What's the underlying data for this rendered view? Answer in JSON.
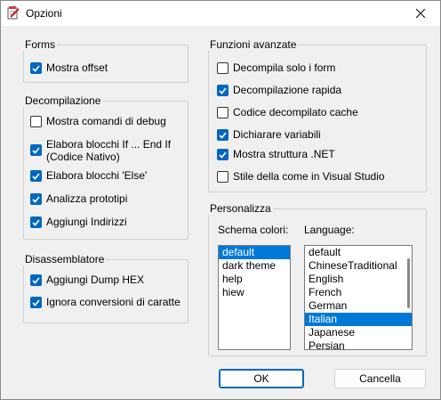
{
  "window": {
    "title": "Opzioni"
  },
  "forms": {
    "title": "Forms",
    "items": [
      {
        "label": "Mostra offset",
        "checked": true
      }
    ]
  },
  "decompilazione": {
    "title": "Decompilazione",
    "items": [
      {
        "label": "Mostra comandi di debug",
        "checked": false
      },
      {
        "label": "Elabora blocchi If ... End If\n(Codice Nativo)",
        "checked": true
      },
      {
        "label": "Elabora blocchi 'Else'",
        "checked": true
      },
      {
        "label": "Analizza prototipi",
        "checked": true
      },
      {
        "label": "Aggiungi Indirizzi",
        "checked": true
      }
    ]
  },
  "disassemblatore": {
    "title": "Disassemblatore",
    "items": [
      {
        "label": "Aggiungi Dump HEX",
        "checked": true
      },
      {
        "label": "Ignora conversioni di caratte",
        "checked": true
      }
    ]
  },
  "funzioni": {
    "title": "Funzioni avanzate",
    "items": [
      {
        "label": "Decompila solo i form",
        "checked": false
      },
      {
        "label": "Decompilazione rapida",
        "checked": true
      },
      {
        "label": "Codice decompilato cache",
        "checked": false
      },
      {
        "label": "Dichiarare variabili",
        "checked": true
      },
      {
        "label": "Mostra struttura .NET",
        "checked": true
      },
      {
        "label": "Stile della come in Visual Studio",
        "checked": false
      }
    ]
  },
  "personalizza": {
    "title": "Personalizza",
    "schema_label": "Schema colori:",
    "schema_items": [
      "default",
      "dark theme",
      "help",
      "hiew"
    ],
    "schema_selected": 0,
    "language_label": "Language:",
    "language_items": [
      "default",
      "ChineseTraditional",
      "English",
      "French",
      "German",
      "Italian",
      "Japanese",
      "Persian"
    ],
    "language_selected": 5
  },
  "buttons": {
    "ok": "OK",
    "cancel": "Cancella"
  },
  "colors": {
    "accent": "#0067c0",
    "selection": "#0078d7"
  }
}
